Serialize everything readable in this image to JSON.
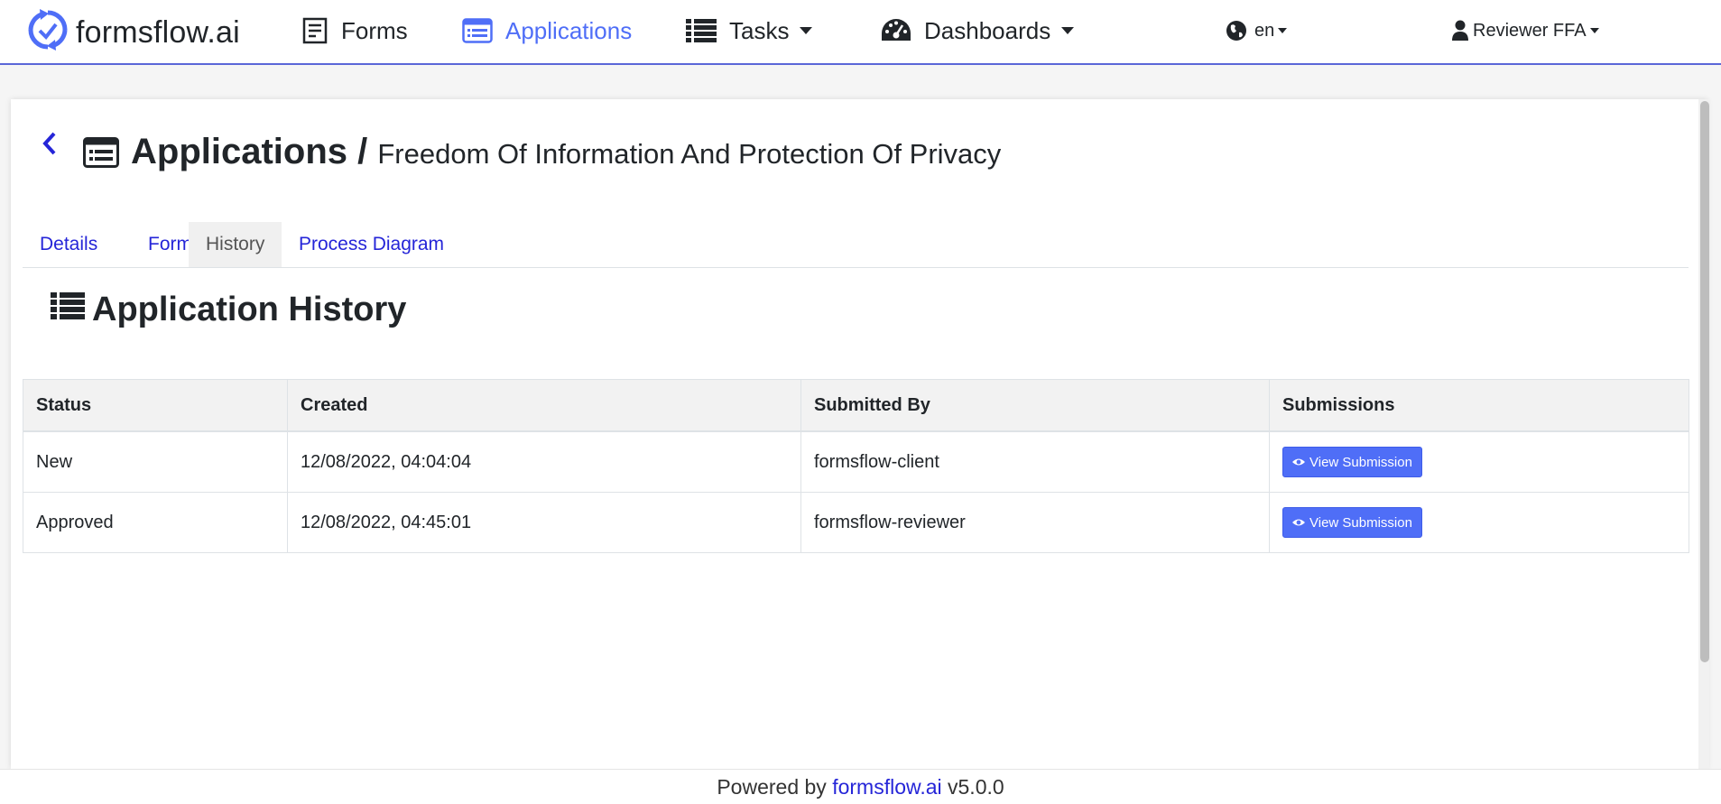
{
  "nav": {
    "brand": "formsflow.ai",
    "forms": "Forms",
    "applications": "Applications",
    "tasks": "Tasks",
    "dashboards": "Dashboards",
    "language": "en",
    "user": "Reviewer FFA",
    "active_color": "#4f6ef7"
  },
  "header": {
    "title": "Applications /",
    "subtitle": "Freedom Of Information And Protection Of Privacy"
  },
  "tabs": [
    {
      "label": "Details"
    },
    {
      "label": "Form"
    },
    {
      "label": "History",
      "active": true
    },
    {
      "label": "Process Diagram"
    }
  ],
  "history": {
    "title": "Application History",
    "columns": [
      "Status",
      "Created",
      "Submitted By",
      "Submissions"
    ],
    "rows": [
      {
        "status": "New",
        "created": "12/08/2022, 04:04:04",
        "submitted_by": "formsflow-client",
        "action": "View Submission"
      },
      {
        "status": "Approved",
        "created": "12/08/2022, 04:45:01",
        "submitted_by": "formsflow-reviewer",
        "action": "View Submission"
      }
    ]
  },
  "footer": {
    "prefix": "Powered by",
    "link": "formsflow.ai",
    "version": "v5.0.0"
  },
  "icons": {
    "brand": "formsflow-logo-icon",
    "forms": "form-icon",
    "applications": "list-alt-icon",
    "tasks": "list-icon",
    "dashboards": "dashboard-gauge-icon",
    "language": "globe-icon",
    "user": "user-icon",
    "back": "chevron-left-icon",
    "view": "eye-icon"
  }
}
